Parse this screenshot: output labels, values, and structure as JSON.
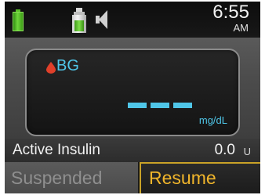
{
  "status_bar": {
    "battery_icon": "battery-full-icon",
    "reservoir_icon": "insulin-reservoir-icon",
    "sound_icon": "speaker-icon",
    "time": "6:55",
    "ampm": "AM"
  },
  "bg_panel": {
    "drop_icon": "blood-drop-icon",
    "label": "BG",
    "value_display": "---",
    "unit": "mg/dL"
  },
  "active_insulin": {
    "label": "Active Insulin",
    "value": "0.0",
    "unit": "U"
  },
  "buttons": {
    "left_label": "Suspended",
    "right_label": "Resume"
  },
  "colors": {
    "accent_bg": "#4fc6e8",
    "resume_text": "#f0b52b",
    "resume_border": "#c9a227",
    "battery_green": "#6fd63a",
    "drop_red": "#e0402a"
  }
}
